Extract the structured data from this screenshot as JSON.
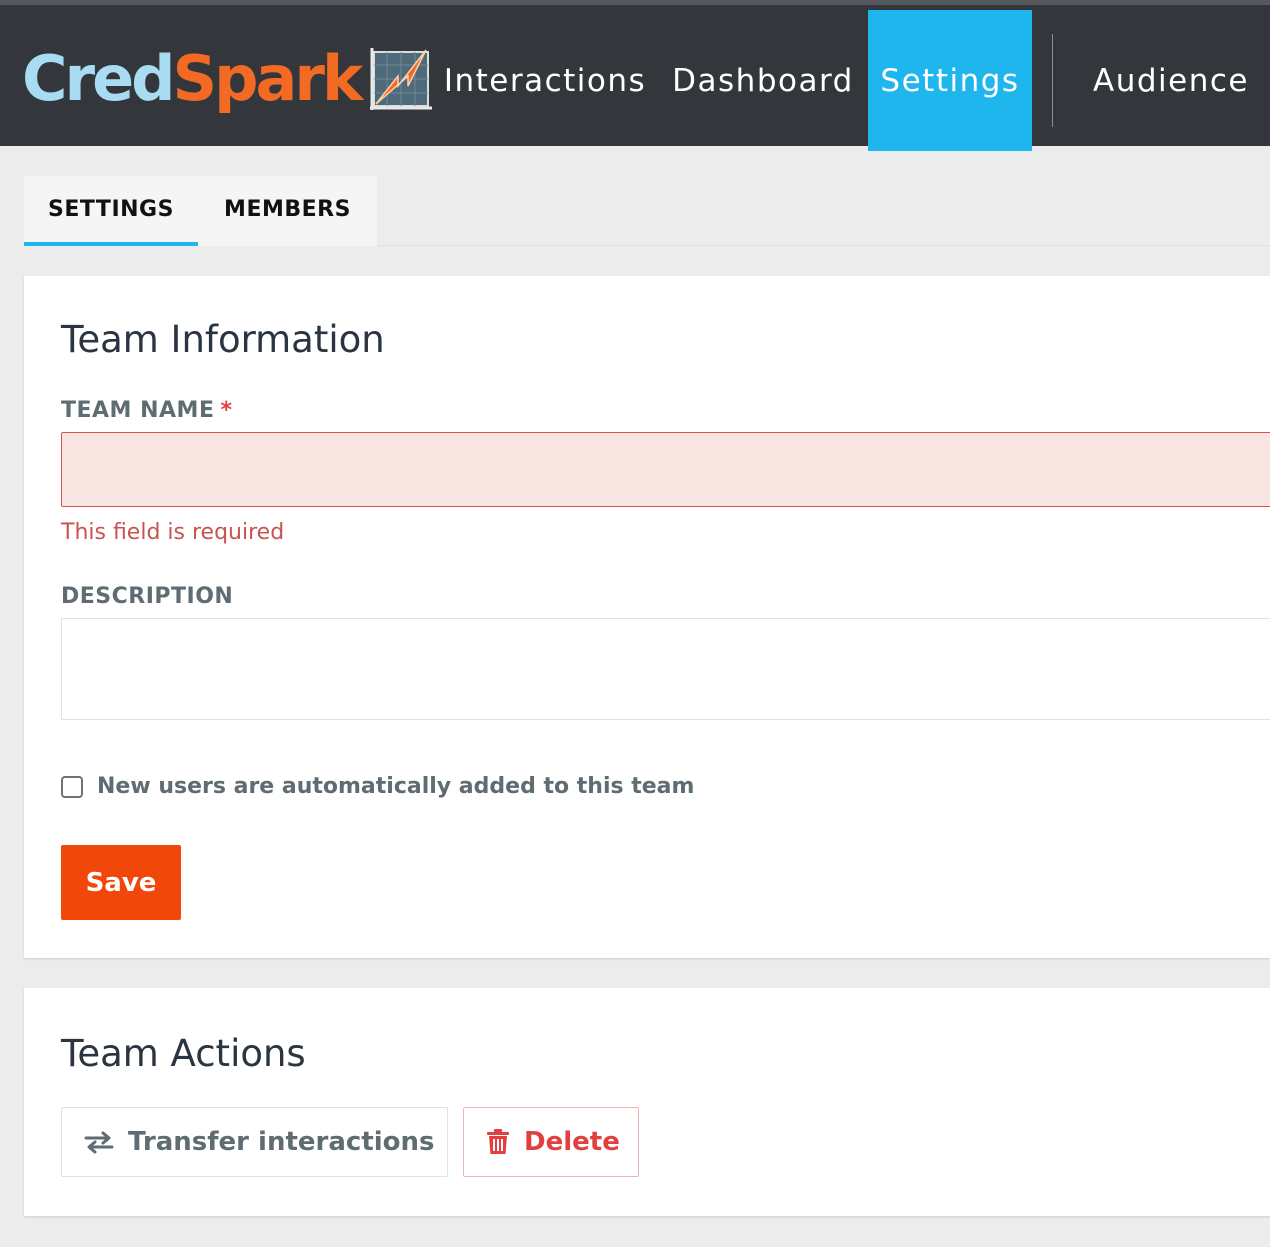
{
  "brand": {
    "name_part1": "Cred",
    "name_part2": "Spark",
    "colors": {
      "cred": "#a8dcf2",
      "spark": "#f26a24",
      "icon_bolt": "#f26a24"
    }
  },
  "nav": {
    "items": [
      {
        "label": "Interactions",
        "active": false
      },
      {
        "label": "Dashboard",
        "active": false
      },
      {
        "label": "Settings",
        "active": true
      },
      {
        "label": "Audience",
        "active": false
      }
    ],
    "active_color": "#1fb6ee",
    "bar_color": "#33373b"
  },
  "tabs": {
    "items": [
      {
        "label": "SETTINGS",
        "active": true
      },
      {
        "label": "MEMBERS",
        "active": false
      }
    ]
  },
  "team_info": {
    "title": "Team Information",
    "team_name_label": "TEAM NAME",
    "required_marker": "*",
    "team_name_value": "",
    "error_text": "This field is required",
    "description_label": "DESCRIPTION",
    "description_value": "",
    "auto_add_checkbox": {
      "label": "New users are automatically added to this team",
      "checked": false
    },
    "save_label": "Save",
    "save_color": "#f2470b"
  },
  "team_actions": {
    "title": "Team Actions",
    "transfer_label": "Transfer interactions",
    "transfer_icon": "transfer-arrows-icon",
    "delete_label": "Delete",
    "delete_icon": "trash-icon",
    "delete_color": "#e33f3f"
  }
}
